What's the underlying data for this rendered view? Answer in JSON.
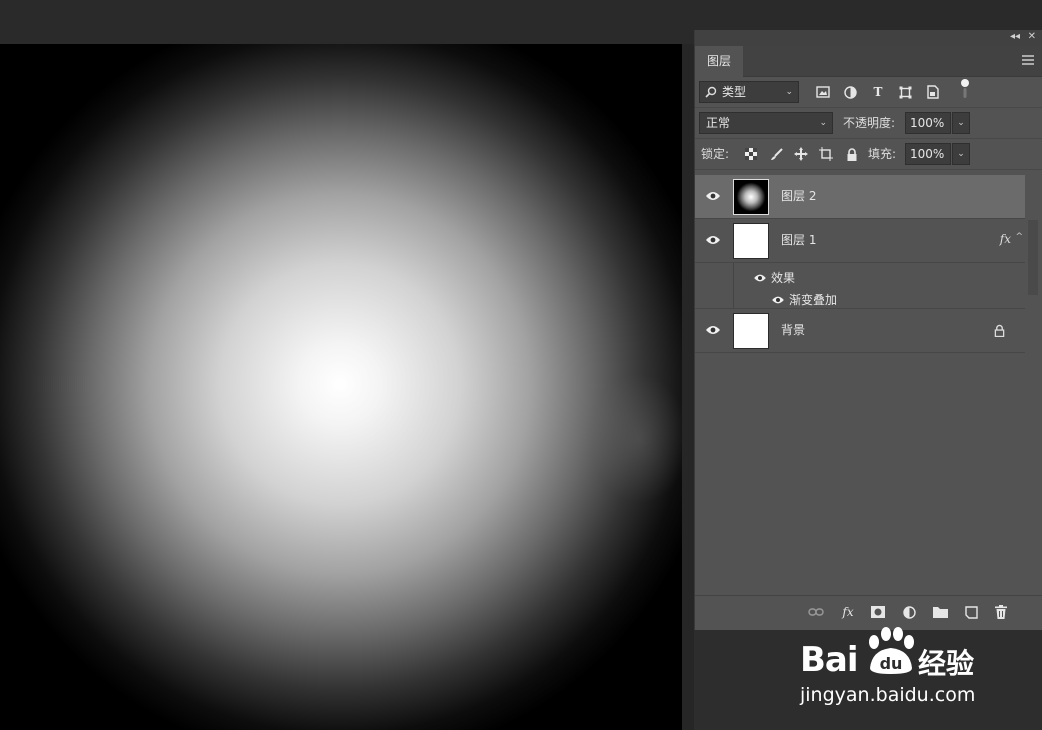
{
  "panel": {
    "controls": {
      "collapse": "◂◂",
      "close": "✕"
    },
    "tab_label": "图层",
    "filter": {
      "kind_label": "类型"
    },
    "blend": {
      "mode": "正常",
      "opacity_label": "不透明度:",
      "opacity_value": "100%"
    },
    "lock": {
      "label": "锁定:",
      "fill_label": "填充:",
      "fill_value": "100%"
    }
  },
  "layers": [
    {
      "name": "图层 2",
      "selected": true,
      "thumbnail": "radial-gradient"
    },
    {
      "name": "图层 1",
      "selected": false,
      "fx": "fx",
      "effects_label": "效果",
      "effect_item": "渐变叠加"
    },
    {
      "name": "背景",
      "selected": false,
      "locked": true
    }
  ],
  "bottom_bar": {
    "fx_label": "fx"
  },
  "watermark": {
    "logo_text": "Bai",
    "logo_suffix": "经验",
    "url": "jingyan.baidu.com"
  },
  "colors": {
    "panel_bg": "#535353",
    "selected_row": "#6b6b6b",
    "canvas_center": "#ffffff",
    "canvas_edge": "#000000"
  }
}
